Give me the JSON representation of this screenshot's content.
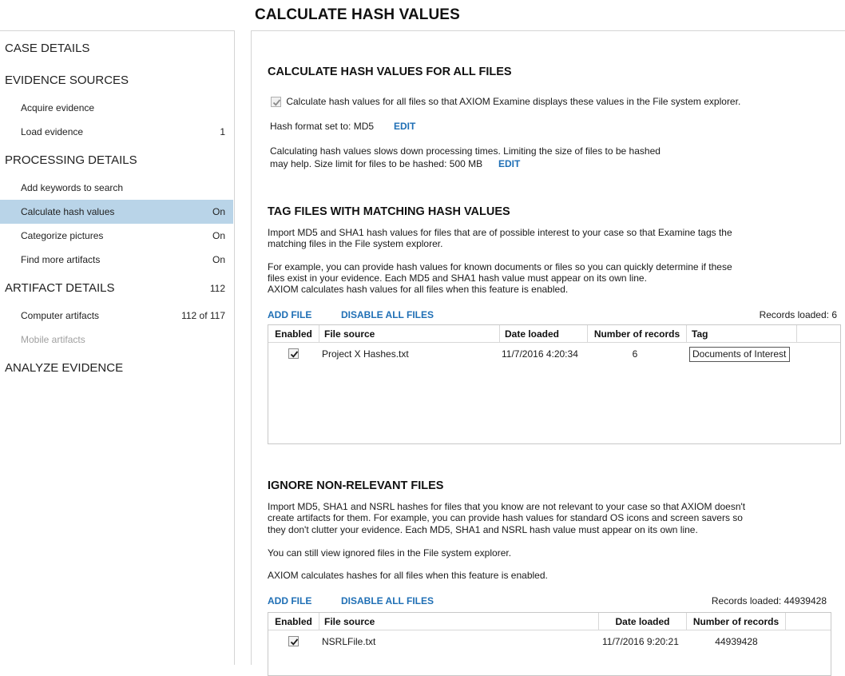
{
  "page": {
    "title": "CALCULATE HASH VALUES"
  },
  "sidebar": {
    "case_details": "CASE DETAILS",
    "evidence_sources": "EVIDENCE SOURCES",
    "acquire_evidence": "Acquire evidence",
    "load_evidence": "Load evidence",
    "load_evidence_count": "1",
    "processing_details": "PROCESSING DETAILS",
    "add_keywords": "Add keywords to search",
    "calculate_hash": "Calculate hash values",
    "calculate_hash_status": "On",
    "categorize_pictures": "Categorize pictures",
    "categorize_pictures_status": "On",
    "find_more_artifacts": "Find more artifacts",
    "find_more_artifacts_status": "On",
    "artifact_details": "ARTIFACT DETAILS",
    "artifact_details_count": "112",
    "computer_artifacts": "Computer artifacts",
    "computer_artifacts_count": "112 of 117",
    "mobile_artifacts": "Mobile artifacts",
    "analyze_evidence": "ANALYZE EVIDENCE"
  },
  "calc": {
    "heading": "CALCULATE HASH VALUES FOR ALL FILES",
    "checkbox_label": "Calculate hash values for all files so that AXIOM Examine displays these values in the File system explorer.",
    "checked": true,
    "format_text": "Hash format set to: MD5",
    "edit_label": "EDIT",
    "limit_line1": "Calculating hash values slows down processing times. Limiting the size of files to be hashed",
    "limit_line2": "may help. Size limit for files to be hashed: 500 MB",
    "limit_edit_label": "EDIT"
  },
  "tag": {
    "heading": "TAG FILES WITH MATCHING HASH VALUES",
    "desc_line1": "Import MD5 and SHA1 hash values for files that are of possible interest to your case so that Examine tags the",
    "desc_line2": "matching files in the File system explorer.",
    "example_line1": "For example, you can provide hash values for known documents or files so you can quickly determine if these",
    "example_line2": "files exist in your evidence. Each MD5 and SHA1 hash value must appear on its own line.",
    "example_line3": "AXIOM calculates hash values for all files when this feature is enabled.",
    "add_file": "ADD FILE",
    "disable_all": "DISABLE ALL FILES",
    "records_loaded": "Records loaded: 6",
    "columns": [
      "Enabled",
      "File source",
      "Date loaded",
      "Number of records",
      "Tag"
    ],
    "rows": [
      {
        "enabled": true,
        "file_source": "Project X Hashes.txt",
        "date_loaded": "11/7/2016 4:20:34",
        "records": "6",
        "tag": "Documents of Interest"
      }
    ]
  },
  "ignore": {
    "heading": "IGNORE NON-RELEVANT FILES",
    "desc_line1": "Import MD5, SHA1 and NSRL hashes for files that you know are not relevant to your case so that AXIOM doesn't",
    "desc_line2": "create artifacts for them. For example, you can provide hash values for standard OS icons and screen savers so",
    "desc_line3": "they don't clutter your evidence. Each MD5, SHA1 and NSRL hash value must appear on its own line.",
    "view_note": "You can still view ignored files in the File system explorer.",
    "calc_note": "AXIOM calculates hashes for all files when this feature is enabled.",
    "add_file": "ADD FILE",
    "disable_all": "DISABLE ALL FILES",
    "records_loaded": "Records loaded: 44939428",
    "columns": [
      "Enabled",
      "File source",
      "Date loaded",
      "Number of records"
    ],
    "rows": [
      {
        "enabled": true,
        "file_source": "NSRLFile.txt",
        "date_loaded": "11/7/2016 9:20:21",
        "records": "44939428"
      }
    ]
  },
  "colors": {
    "accent_link": "#1f6fb5",
    "selected_bg": "#b9d4e8"
  }
}
